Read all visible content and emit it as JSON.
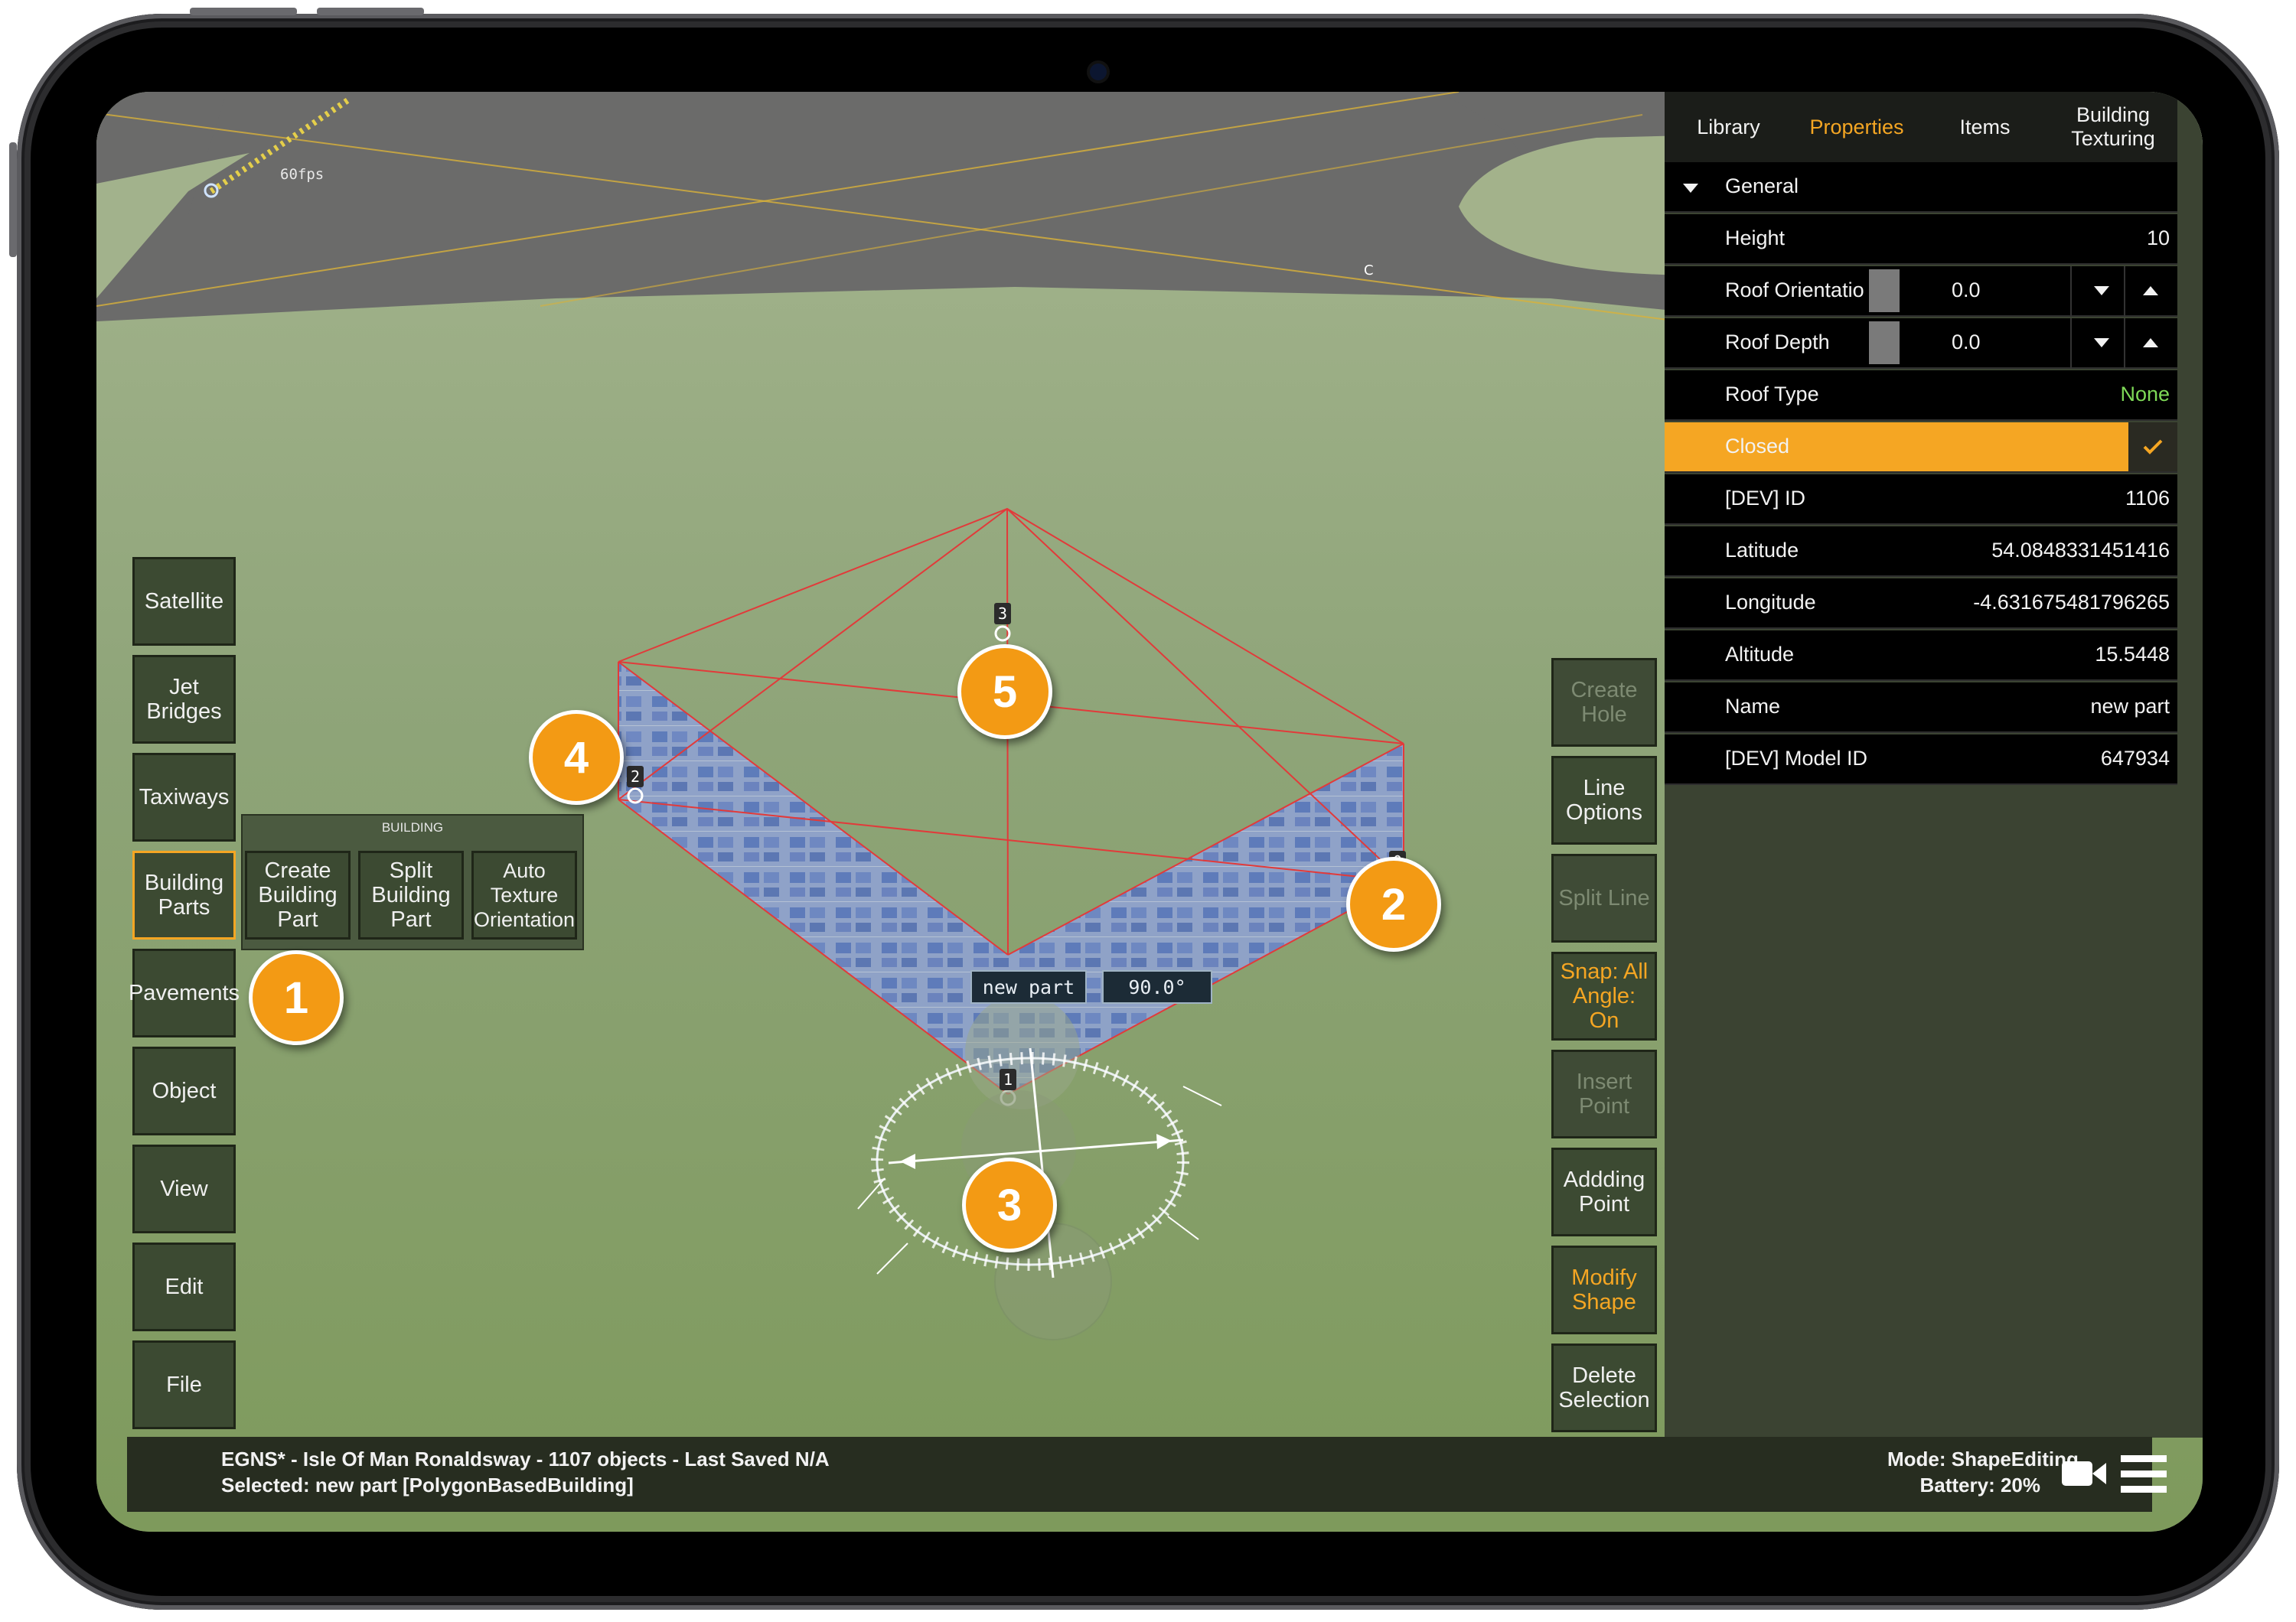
{
  "viewport": {
    "fps_label": "60fps",
    "marker_c": "C"
  },
  "left_toolbar": [
    "Satellite",
    "Jet Bridges",
    "Taxiways",
    "Building Parts",
    "Pavements",
    "Object",
    "View",
    "Edit",
    "File"
  ],
  "building_panel": {
    "title": "BUILDING",
    "buttons": [
      "Create Building Part",
      "Split Building Part",
      "Auto Texture Orientation"
    ]
  },
  "right_toolbar": [
    "Create Hole",
    "Line Options",
    "Split Line",
    "Snap: All Angle: On",
    "Insert Point",
    "Addding Point",
    "Modify Shape",
    "Delete Selection"
  ],
  "tabs": [
    "Library",
    "Properties",
    "Items",
    "Building Texturing"
  ],
  "properties": {
    "section": "General",
    "height": {
      "label": "Height",
      "value": "10"
    },
    "roof_orientation": {
      "label": "Roof Orientatio",
      "value": "0.0"
    },
    "roof_depth": {
      "label": "Roof Depth",
      "value": "0.0"
    },
    "roof_type": {
      "label": "Roof Type",
      "value": "None"
    },
    "closed": {
      "label": "Closed",
      "checked": true
    },
    "dev_id": {
      "label": "[DEV] ID",
      "value": "1106"
    },
    "latitude": {
      "label": "Latitude",
      "value": "54.0848331451416"
    },
    "longitude": {
      "label": "Longitude",
      "value": "-4.631675481796265"
    },
    "altitude": {
      "label": "Altitude",
      "value": "15.5448"
    },
    "name": {
      "label": "Name",
      "value": "new part"
    },
    "model_id": {
      "label": "[DEV] Model ID",
      "value": "647934"
    }
  },
  "vertex_labels": [
    "0",
    "1",
    "2",
    "3"
  ],
  "selection_chip": {
    "name": "new part",
    "angle": "90.0°"
  },
  "callouts": [
    "1",
    "2",
    "3",
    "4",
    "5"
  ],
  "status": {
    "line1": "EGNS* - Isle Of Man Ronaldsway - 1107 objects - Last Saved N/A",
    "line2": "Selected: new part [PolygonBasedBuilding]",
    "mode": "Mode: ShapeEditing",
    "battery": "Battery: 20%"
  },
  "colors": {
    "accent": "#f5a623",
    "grass": "#7d9766",
    "tarmac": "#6b6b6b",
    "wireframe": "#e23a3a"
  }
}
